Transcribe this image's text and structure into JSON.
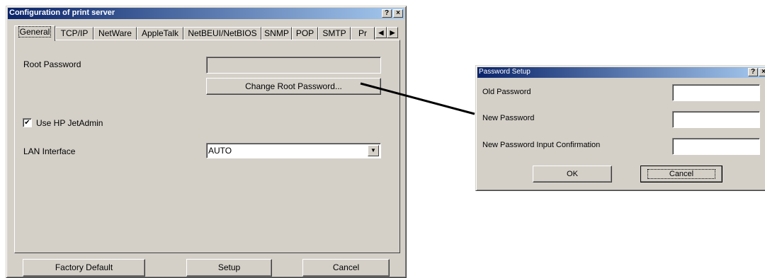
{
  "main_window": {
    "title": "Configuration of print server",
    "help_btn": "?",
    "close_btn": "×",
    "tabs": [
      "General",
      "TCP/IP",
      "NetWare",
      "AppleTalk",
      "NetBEUI/NetBIOS",
      "SNMP",
      "POP",
      "SMTP",
      "Pr"
    ],
    "scroll_left": "◀",
    "scroll_right": "▶",
    "root_password_label": "Root Password",
    "root_password_value": "",
    "change_root_password_btn": "Change Root Password...",
    "use_hp_jetadmin_label": "Use HP JetAdmin",
    "use_hp_jetadmin_checked": true,
    "checkmark": "✔",
    "lan_interface_label": "LAN Interface",
    "lan_interface_value": "AUTO",
    "dropdown_arrow": "▼",
    "footer": {
      "factory_default": "Factory Default",
      "setup": "Setup",
      "cancel": "Cancel"
    }
  },
  "password_dialog": {
    "title": "Password Setup",
    "help_btn": "?",
    "close_btn": "×",
    "old_password_label": "Old Password",
    "new_password_label": "New Password",
    "confirm_label": "New Password Input Confirmation",
    "ok": "OK",
    "cancel": "Cancel"
  }
}
